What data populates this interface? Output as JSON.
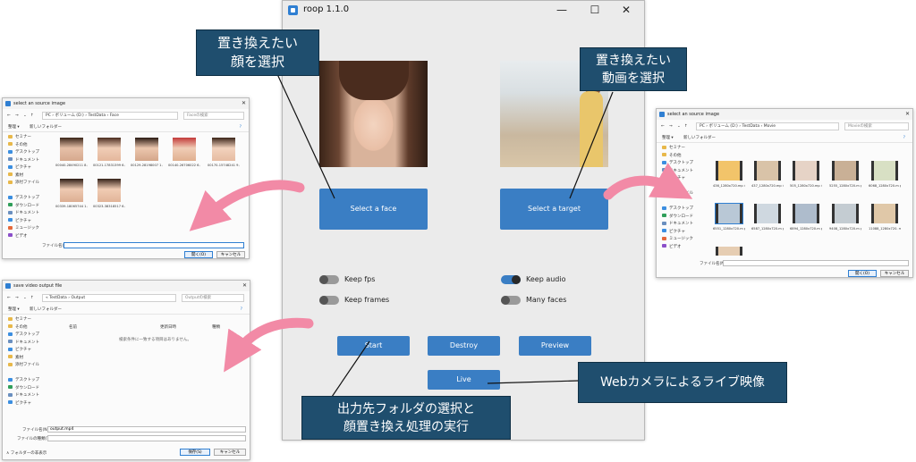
{
  "roop": {
    "title": "roop 1.1.0",
    "minimize": "—",
    "maximize": "☐",
    "close": "✕",
    "select_face": "Select a face",
    "select_target": "Select a target",
    "keep_fps": "Keep fps",
    "keep_audio": "Keep audio",
    "keep_frames": "Keep frames",
    "many_faces": "Many faces",
    "start": "Start",
    "destroy": "Destroy",
    "preview": "Preview",
    "live": "Live",
    "toggles": {
      "keep_fps": false,
      "keep_audio": true,
      "keep_frames": false,
      "many_faces": false
    },
    "accent_color": "#3a7ec4"
  },
  "callouts": {
    "face_line1": "置き換えたい",
    "face_line2": "顔を選択",
    "target_line1": "置き換えたい",
    "target_line2": "動画を選択",
    "output_line1": "出力先フォルダの選択と",
    "output_line2": "顔置き換え処理の実行",
    "webcam": "Webカメラによるライブ映像",
    "color": "#1f4e6e"
  },
  "source_dialog": {
    "title": "select an source image",
    "address": "PC  ›  ボリューム (D:)  ›  TestData  ›  Face",
    "search": "Faceの検索",
    "organize": "整理 ▾",
    "new_folder": "新しいフォルダー",
    "sidebar": [
      "セミナー",
      "その他",
      "デスクトップ",
      "ドキュメント",
      "ピクチャ",
      "素材",
      "添付ファイル",
      "",
      "デスクトップ",
      "ダウンロード",
      "ドキュメント",
      "ピクチャ",
      "ミュージック",
      "ビデオ"
    ],
    "files": [
      "00040-28490211 8.png",
      "00121-17831399 6.png",
      "00129-28198007 1.png",
      "00140-26706022 6.png",
      "00170-15748241 9.png",
      "00339-18065744 1.png",
      "00323-38318517 6.png"
    ],
    "filename_label": "ファイル名(N):",
    "open": "開く(O)",
    "cancel": "キャンセル"
  },
  "target_dialog": {
    "title": "select an source image",
    "address": "PC  ›  ボリューム (D:)  ›  TestData  ›  Movie",
    "search": "Movieの検索",
    "organize": "整理 ▾",
    "new_folder": "新しいフォルダー",
    "sidebar": [
      "セミナー",
      "その他",
      "デスクトップ",
      "ドキュメント",
      "ピクチャ",
      "素材",
      "添付ファイル",
      "",
      "デスクトップ",
      "ダウンロード",
      "ドキュメント",
      "ピクチャ",
      "ミュージック",
      "ビデオ"
    ],
    "files": [
      "436_1280x720.mp 4",
      "437_1280x720.mp 4",
      "505_1280x720.mp 4",
      "5255_1280x720.m p4",
      "6068_1280x720.m p4",
      "6551_1280x720.m p4",
      "6587_1280x720.m p4",
      "6894_1280x720.m p4",
      "9408_1280x720.m p4",
      "11088_1280x720. mp4"
    ],
    "filename_label": "ファイル名(N):",
    "open": "開く(O)",
    "cancel": "キャンセル"
  },
  "save_dialog": {
    "title": "save video output file",
    "address": "«  TestData  ›  Output",
    "search": "Outputの検索",
    "organize": "整理 ▾",
    "new_folder": "新しいフォルダー",
    "sidebar": [
      "セミナー",
      "その他",
      "デスクトップ",
      "ドキュメント",
      "ピクチャ",
      "素材",
      "添付ファイル",
      "",
      "デスクトップ",
      "ダウンロード",
      "ドキュメント",
      "ピクチャ"
    ],
    "col_name": "名前",
    "col_date": "更新日時",
    "col_type": "種類",
    "empty_msg": "検索条件に一致する項目はありません。",
    "filename_label": "ファイル名(N):",
    "filename_value": "output.mp4",
    "filetype_label": "ファイルの種類(T):",
    "hide_folders": "∧ フォルダーの非表示",
    "save": "保存(S)",
    "cancel": "キャンセル"
  }
}
